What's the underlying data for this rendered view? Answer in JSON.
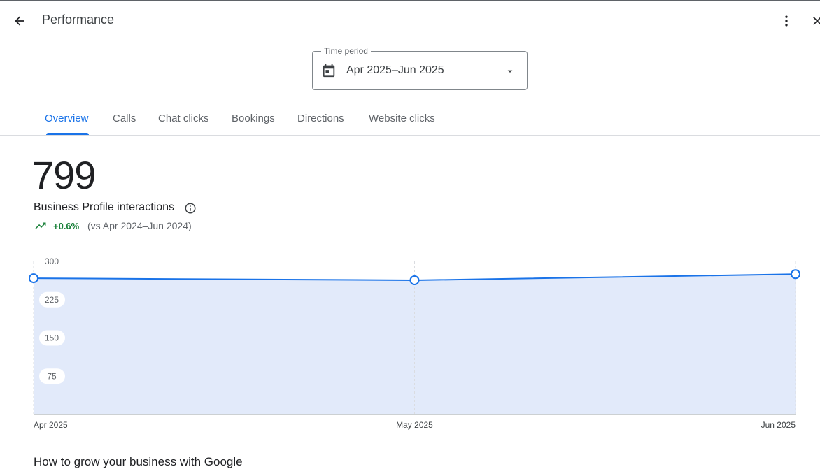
{
  "header": {
    "title": "Performance"
  },
  "time_period": {
    "label": "Time period",
    "value": "Apr 2025–Jun 2025"
  },
  "tabs": [
    {
      "label": "Overview",
      "active": true
    },
    {
      "label": "Calls",
      "active": false
    },
    {
      "label": "Chat clicks",
      "active": false
    },
    {
      "label": "Bookings",
      "active": false
    },
    {
      "label": "Directions",
      "active": false
    },
    {
      "label": "Website clicks",
      "active": false
    }
  ],
  "metric": {
    "total": "799",
    "label": "Business Profile interactions",
    "change": "+0.6%",
    "comparison": "(vs Apr 2024–Jun 2024)"
  },
  "chart_data": {
    "type": "area",
    "categories": [
      "Apr 2025",
      "May 2025",
      "Jun 2025"
    ],
    "values": [
      267,
      263,
      275
    ],
    "ylim": [
      0,
      300
    ],
    "yticks": [
      "300",
      "225",
      "150",
      "75"
    ],
    "grid": true,
    "color": "#1a73e8",
    "fill_color": "#e2eafa"
  },
  "footer": {
    "heading": "How to grow your business with Google"
  },
  "colors": {
    "accent": "#1a73e8",
    "positive": "#188038"
  },
  "icons": {
    "back": "arrow-back-icon",
    "more": "more-vert-icon",
    "close": "close-icon",
    "calendar": "calendar-icon",
    "dropdown": "arrow-drop-down-icon",
    "info": "info-icon",
    "trend": "trending-up-icon"
  }
}
